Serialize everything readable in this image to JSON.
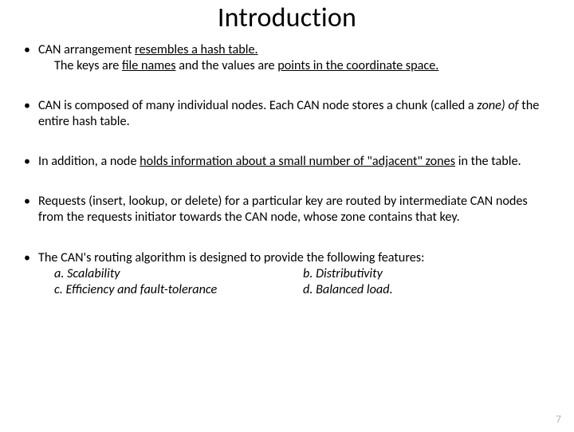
{
  "title": "Introduction",
  "b1": {
    "pre": "CAN arrangement ",
    "u1": "resembles a hash table.",
    "line2a": "The keys are ",
    "line2u1": "file names",
    "line2mid": " and the values are ",
    "line2u2": "points in the coordinate space.",
    "end": ""
  },
  "b2": {
    "pre": "CAN is composed of many individual nodes. Each CAN node stores a chunk (called a ",
    "it": "zone) of",
    "post": " the entire hash table."
  },
  "b3": {
    "pre": "In addition, a node ",
    "u1": "holds information about a small number of \"adjacent\" zones",
    "post": " in the table."
  },
  "b4": "Requests (insert, lookup, or delete) for a particular key are routed by intermediate CAN nodes from the requests initiator towards the CAN node, whose zone contains that key.",
  "b5": {
    "lead": "The CAN's routing algorithm is designed to provide the following features:",
    "a": "a. Scalability",
    "b": "b. Distributivity",
    "c": "c. Efficiency and fault-tolerance",
    "d": " d. Balanced load."
  },
  "pagenum": "7"
}
